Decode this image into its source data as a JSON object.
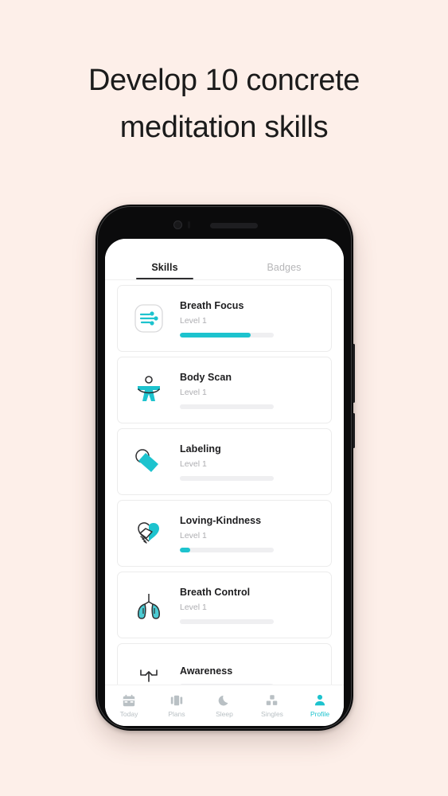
{
  "headline": {
    "line1": "Develop 10 concrete",
    "line2": "meditation skills"
  },
  "colors": {
    "background": "#FDEFE9",
    "accent": "#1DC3CE",
    "text_dark": "#1D1D1F",
    "text_muted": "#AEAEB2",
    "track": "#EFEFF1"
  },
  "app": {
    "tabs": [
      {
        "label": "Skills",
        "active": true
      },
      {
        "label": "Badges",
        "active": false
      }
    ],
    "skills": [
      {
        "title": "Breath Focus",
        "level": "Level 1",
        "progress": 75,
        "icon": "breath-focus-icon"
      },
      {
        "title": "Body Scan",
        "level": "Level 1",
        "progress": 0,
        "icon": "body-scan-icon"
      },
      {
        "title": "Labeling",
        "level": "Level 1",
        "progress": 0,
        "icon": "labeling-tag-icon"
      },
      {
        "title": "Loving-Kindness",
        "level": "Level 1",
        "progress": 11,
        "icon": "loving-kindness-icon"
      },
      {
        "title": "Breath Control",
        "level": "Level 1",
        "progress": 0,
        "icon": "lungs-icon"
      },
      {
        "title": "Awareness",
        "level": "",
        "progress": 0,
        "icon": "awareness-expand-icon"
      }
    ],
    "nav": [
      {
        "label": "Today",
        "icon": "calendar-icon",
        "active": false
      },
      {
        "label": "Plans",
        "icon": "cards-icon",
        "active": false
      },
      {
        "label": "Sleep",
        "icon": "moon-icon",
        "active": false
      },
      {
        "label": "Singles",
        "icon": "grid-icon",
        "active": false
      },
      {
        "label": "Profile",
        "icon": "person-icon",
        "active": true
      }
    ]
  }
}
